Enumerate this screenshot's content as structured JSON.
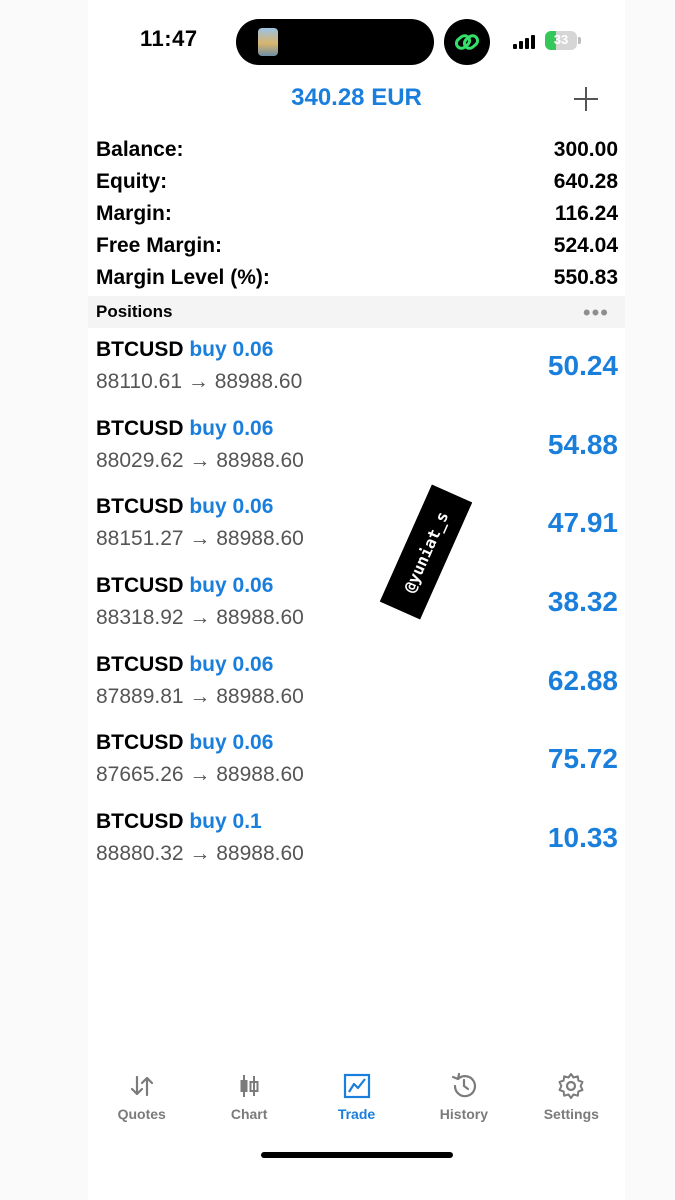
{
  "status": {
    "time": "11:47",
    "battery": "33"
  },
  "header": {
    "title": "340.28 EUR",
    "add_icon": "plus-icon"
  },
  "summary": [
    {
      "label": "Balance:",
      "value": "300.00"
    },
    {
      "label": "Equity:",
      "value": "640.28"
    },
    {
      "label": "Margin:",
      "value": "116.24"
    },
    {
      "label": "Free Margin:",
      "value": "524.04"
    },
    {
      "label": "Margin Level (%):",
      "value": "550.83"
    }
  ],
  "positions": {
    "title": "Positions",
    "more": "•••",
    "items": [
      {
        "symbol": "BTCUSD",
        "side": "buy 0.06",
        "prices": "88110.61 → 88988.60",
        "profit": "50.24"
      },
      {
        "symbol": "BTCUSD",
        "side": "buy 0.06",
        "prices": "88029.62 → 88988.60",
        "profit": "54.88"
      },
      {
        "symbol": "BTCUSD",
        "side": "buy 0.06",
        "prices": "88151.27 → 88988.60",
        "profit": "47.91"
      },
      {
        "symbol": "BTCUSD",
        "side": "buy 0.06",
        "prices": "88318.92 → 88988.60",
        "profit": "38.32"
      },
      {
        "symbol": "BTCUSD",
        "side": "buy 0.06",
        "prices": "87889.81 → 88988.60",
        "profit": "62.88"
      },
      {
        "symbol": "BTCUSD",
        "side": "buy 0.06",
        "prices": "87665.26 → 88988.60",
        "profit": "75.72"
      },
      {
        "symbol": "BTCUSD",
        "side": "buy 0.1",
        "prices": "88880.32 → 88988.60",
        "profit": "10.33"
      }
    ]
  },
  "watermark": "@yuniat_s",
  "tabs": [
    {
      "label": "Quotes",
      "icon": "quotes-icon"
    },
    {
      "label": "Chart",
      "icon": "candles-icon"
    },
    {
      "label": "Trade",
      "icon": "trade-icon",
      "active": true
    },
    {
      "label": "History",
      "icon": "history-icon"
    },
    {
      "label": "Settings",
      "icon": "gear-icon"
    }
  ],
  "colors": {
    "accent": "#1a7fdc",
    "muted": "#7b7b7b",
    "battery": "#35c759"
  }
}
